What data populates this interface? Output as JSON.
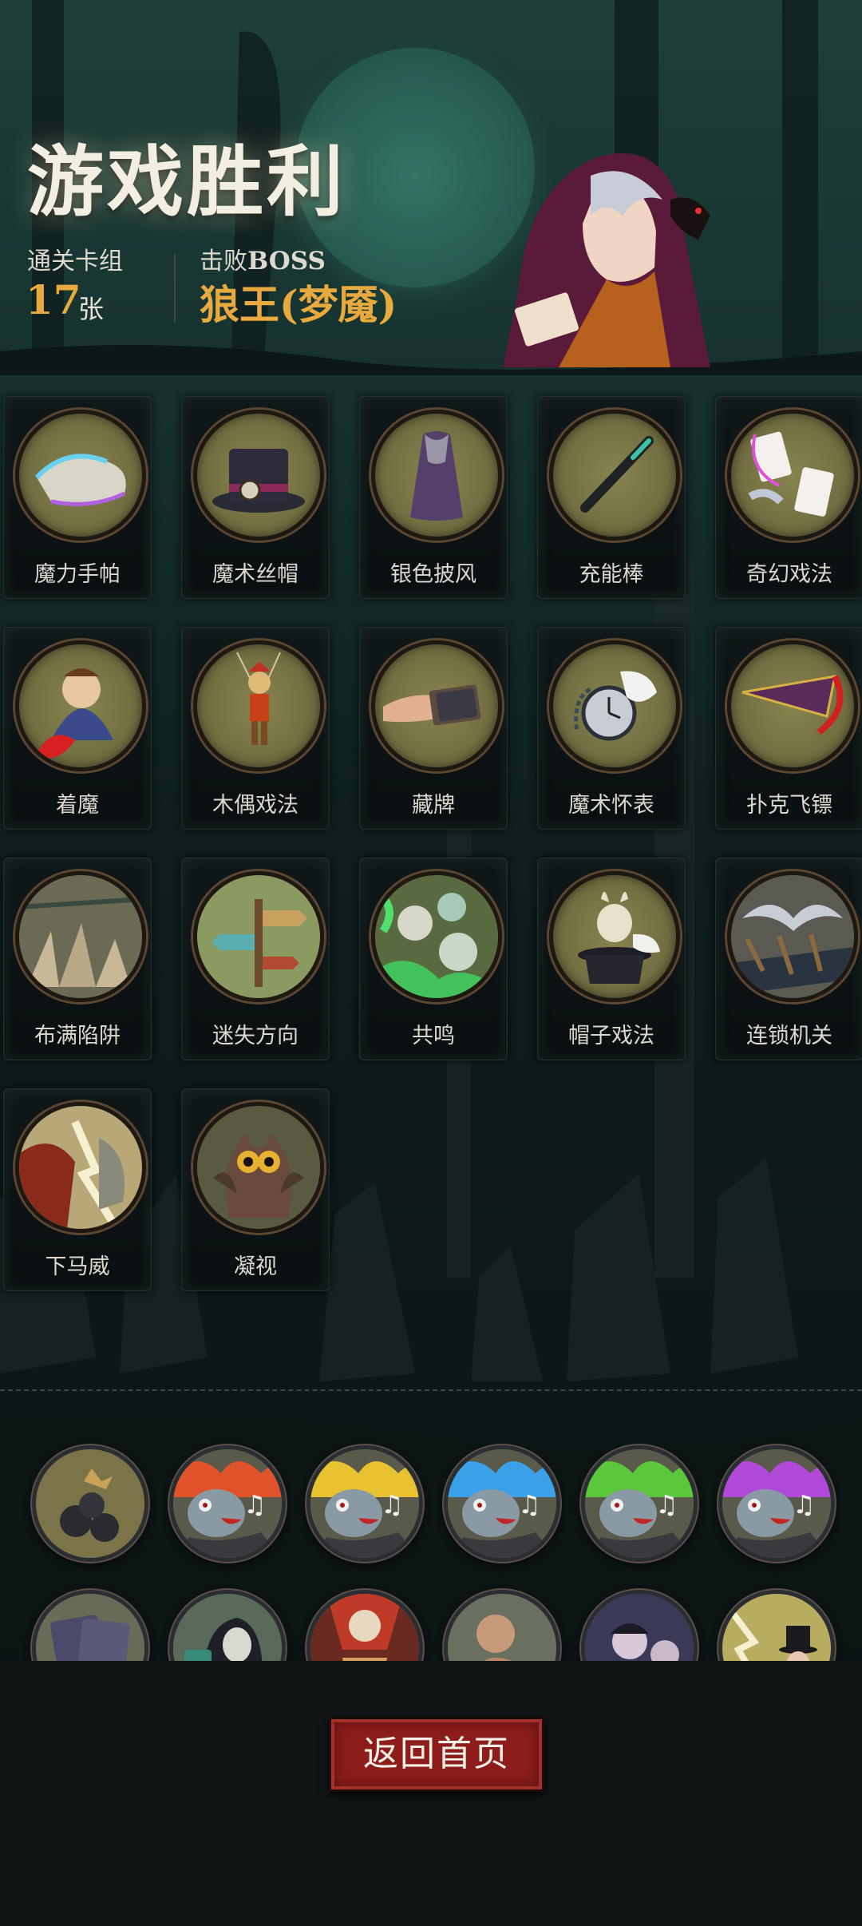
{
  "header": {
    "title": "游戏胜利",
    "deck_label": "通关卡组",
    "deck_count": "17",
    "deck_unit": "张",
    "boss_label_cn": "击败",
    "boss_label_latin": "BOSS",
    "boss_name": "狼王(梦魇)"
  },
  "cards": [
    {
      "label": "魔力手帕",
      "icon": "handkerchief-icon"
    },
    {
      "label": "魔术丝帽",
      "icon": "top-hat-clock-icon"
    },
    {
      "label": "银色披风",
      "icon": "cloak-icon"
    },
    {
      "label": "充能棒",
      "icon": "wand-icon"
    },
    {
      "label": "奇幻戏法",
      "icon": "flying-cards-icon"
    },
    {
      "label": "着魔",
      "icon": "possessed-man-icon"
    },
    {
      "label": "木偶戏法",
      "icon": "puppet-icon"
    },
    {
      "label": "藏牌",
      "icon": "hidden-card-icon"
    },
    {
      "label": "魔术怀表",
      "icon": "pocket-watch-icon"
    },
    {
      "label": "扑克飞镖",
      "icon": "card-dart-icon"
    },
    {
      "label": "布满陷阱",
      "icon": "spike-trap-icon"
    },
    {
      "label": "迷失方向",
      "icon": "signpost-icon"
    },
    {
      "label": "共鸣",
      "icon": "skulls-icon"
    },
    {
      "label": "帽子戏法",
      "icon": "rabbit-hat-icon"
    },
    {
      "label": "连锁机关",
      "icon": "blade-trap-icon"
    },
    {
      "label": "下马威",
      "icon": "claw-strike-icon"
    },
    {
      "label": "凝视",
      "icon": "owl-icon"
    }
  ],
  "relics_row1": [
    {
      "icon": "bomb-pile-icon",
      "color": "#c9a255"
    },
    {
      "icon": "singing-fish-red-icon",
      "color": "#e0522a"
    },
    {
      "icon": "singing-fish-yellow-icon",
      "color": "#e8c230"
    },
    {
      "icon": "singing-fish-blue-icon",
      "color": "#3aa0e8"
    },
    {
      "icon": "singing-fish-green-icon",
      "color": "#5ac83a"
    },
    {
      "icon": "singing-fish-purple-icon",
      "color": "#b048d8"
    }
  ],
  "relics_row2": [
    {
      "icon": "card-deck-icon"
    },
    {
      "icon": "hooded-figure-icon"
    },
    {
      "icon": "red-idol-icon"
    },
    {
      "icon": "brute-icon"
    },
    {
      "icon": "vampire-icon"
    },
    {
      "icon": "magician-icon"
    }
  ],
  "footer": {
    "home_button": "返回首页"
  }
}
